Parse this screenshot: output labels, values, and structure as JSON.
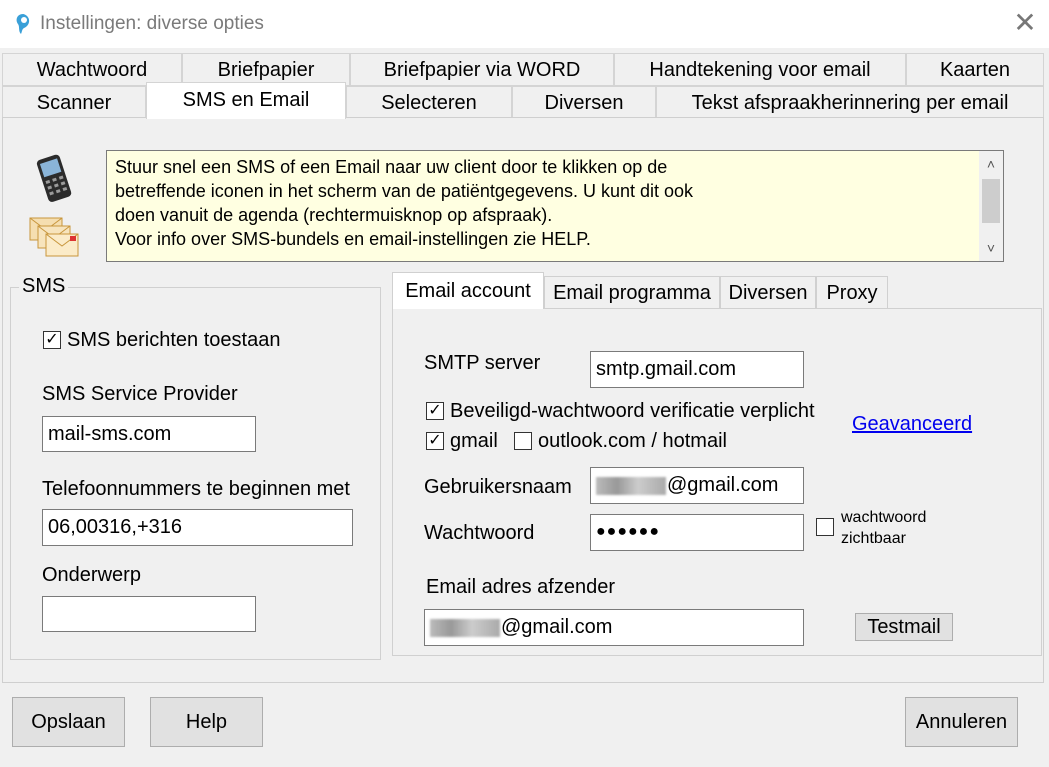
{
  "window": {
    "title": "Instellingen: diverse opties",
    "close_icon": "close-x"
  },
  "tabs_row1": [
    "Wachtwoord",
    "Briefpapier",
    "Briefpapier via WORD",
    "Handtekening voor email",
    "Kaarten"
  ],
  "tabs_row2": [
    "Scanner",
    "SMS en Email",
    "Selecteren",
    "Diversen",
    "Tekst afspraakherinnering per email"
  ],
  "active_tab": "SMS en Email",
  "info": {
    "lines": [
      "Stuur snel een SMS of een Email naar uw client door te klikken op de",
      "betreffende iconen in het scherm van de patiëntgegevens. U kunt dit ook",
      "doen vanuit de agenda (rechtermuisknop op afspraak).",
      "Voor info over SMS-bundels en email-instellingen zie HELP."
    ],
    "scroll_up": "˄",
    "scroll_down": "˅"
  },
  "sms": {
    "group_label": "SMS",
    "allow_label": "SMS berichten toestaan",
    "allow_checked": true,
    "provider_label": "SMS Service Provider",
    "provider_value": "mail-sms.com",
    "phone_label": "Telefoonnummers te beginnen met",
    "phone_value": "06,00316,+316",
    "subject_label": "Onderwerp",
    "subject_value": ""
  },
  "email_tabs": [
    "Email account",
    "Email programma",
    "Diversen",
    "Proxy"
  ],
  "email": {
    "smtp_label": "SMTP server",
    "smtp_value": "smtp.gmail.com",
    "secure_label": "Beveiligd-wachtwoord verificatie verplicht",
    "secure_checked": true,
    "advanced_link": "Geavanceerd",
    "gmail_label": "gmail",
    "gmail_checked": true,
    "outlook_label": "outlook.com / hotmail",
    "outlook_checked": false,
    "username_label": "Gebruikersnaam",
    "username_suffix": "@gmail.com",
    "password_label": "Wachtwoord",
    "password_value": "●●●●●●",
    "show_password_label_1": "wachtwoord",
    "show_password_label_2": "zichtbaar",
    "show_password_checked": false,
    "sender_label": "Email adres afzender",
    "sender_suffix": "@gmail.com",
    "testmail_button": "Testmail"
  },
  "buttons": {
    "save": "Opslaan",
    "help": "Help",
    "cancel": "Annuleren"
  },
  "check_mark": "✓"
}
